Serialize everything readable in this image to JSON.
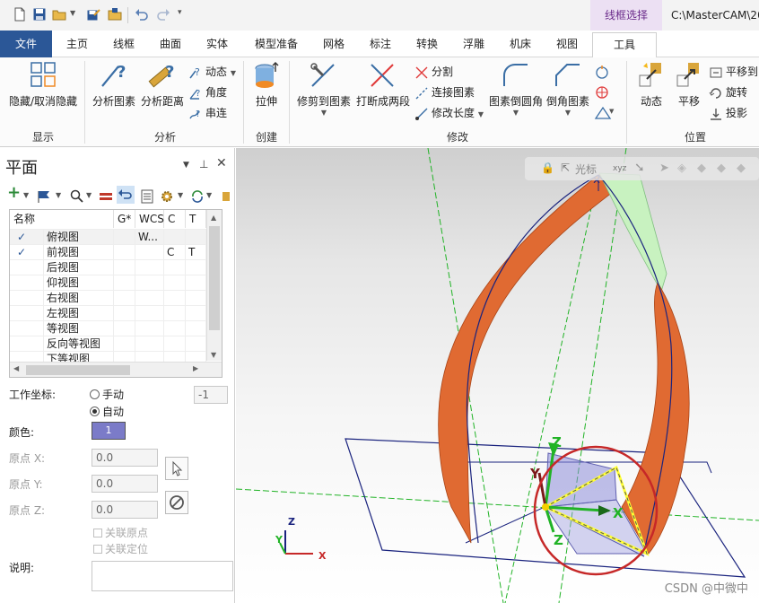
{
  "titlebar": {
    "context_tab": "线框选择",
    "window_title": "C:\\MasterCAM\\20"
  },
  "tabs": [
    {
      "label": "文件"
    },
    {
      "label": "主页"
    },
    {
      "label": "线框"
    },
    {
      "label": "曲面"
    },
    {
      "label": "实体"
    },
    {
      "label": "模型准备"
    },
    {
      "label": "网格"
    },
    {
      "label": "标注"
    },
    {
      "label": "转换"
    },
    {
      "label": "浮雕"
    },
    {
      "label": "机床"
    },
    {
      "label": "视图"
    },
    {
      "label": "工具"
    }
  ],
  "ribbon": {
    "display": {
      "hide_unhide": "隐藏/取消隐藏",
      "group": "显示"
    },
    "analyze": {
      "analyze_entity": "分析图素",
      "analyze_distance": "分析距离",
      "dynamic": "动态",
      "angle": "角度",
      "chain": "串连",
      "group": "分析"
    },
    "create": {
      "extrude": "拉伸",
      "group": "创建"
    },
    "modify": {
      "trim_to_entity": "修剪到图素",
      "break_two": "打断成两段",
      "divide": "分割",
      "join": "连接图素",
      "modify_length": "修改长度",
      "fillet": "图素倒圆角",
      "chamfer": "倒角图素",
      "group": "修改"
    },
    "position": {
      "dynamic": "动态",
      "translate": "平移",
      "translate_to": "平移到",
      "rotate": "旋转",
      "project": "投影",
      "group": "位置"
    }
  },
  "panel": {
    "title": "平面",
    "grid": {
      "headers": [
        "名称",
        "G*",
        "WCS",
        "C",
        "T"
      ],
      "rows": [
        {
          "check": "✓",
          "name": "俯视图",
          "g": "",
          "wcs": "W...",
          "c": "",
          "t": ""
        },
        {
          "check": "✓",
          "name": "前视图",
          "g": "",
          "wcs": "",
          "c": "C",
          "t": "T"
        },
        {
          "check": "",
          "name": "后视图",
          "g": "",
          "wcs": "",
          "c": "",
          "t": ""
        },
        {
          "check": "",
          "name": "仰视图",
          "g": "",
          "wcs": "",
          "c": "",
          "t": ""
        },
        {
          "check": "",
          "name": "右视图",
          "g": "",
          "wcs": "",
          "c": "",
          "t": ""
        },
        {
          "check": "",
          "name": "左视图",
          "g": "",
          "wcs": "",
          "c": "",
          "t": ""
        },
        {
          "check": "",
          "name": "等视图",
          "g": "",
          "wcs": "",
          "c": "",
          "t": ""
        },
        {
          "check": "",
          "name": "反向等视图",
          "g": "",
          "wcs": "",
          "c": "",
          "t": ""
        },
        {
          "check": "",
          "name": "下等视图",
          "g": "",
          "wcs": "",
          "c": "",
          "t": ""
        }
      ]
    },
    "work_coord_label": "工作坐标:",
    "manual_label": "手动",
    "auto_label": "自动",
    "work_coord_value": "-1",
    "color_label": "颜色:",
    "color_value": "1",
    "origin_x_label": "原点 X:",
    "origin_y_label": "原点 Y:",
    "origin_z_label": "原点 Z:",
    "origin_x": "0.0",
    "origin_y": "0.0",
    "origin_z": "0.0",
    "link_origin": "关联原点",
    "link_position": "关联定位",
    "notes_label": "说明:"
  },
  "viewport": {
    "toolbar_label": "光标",
    "axis_labels": {
      "x": "X",
      "y": "Y",
      "z": "Z"
    },
    "watermark": "CSDN @中微中"
  },
  "colors": {
    "file_tab": "#2b5797",
    "surface_orange": "#e06a32",
    "surface_light": "#bfefc0",
    "wire": "#1a237e",
    "axis_green": "#21b326",
    "highlight_circle": "#c62828",
    "highlight_yellow": "#ffff33",
    "color_swatch": "#7b7bc8"
  }
}
